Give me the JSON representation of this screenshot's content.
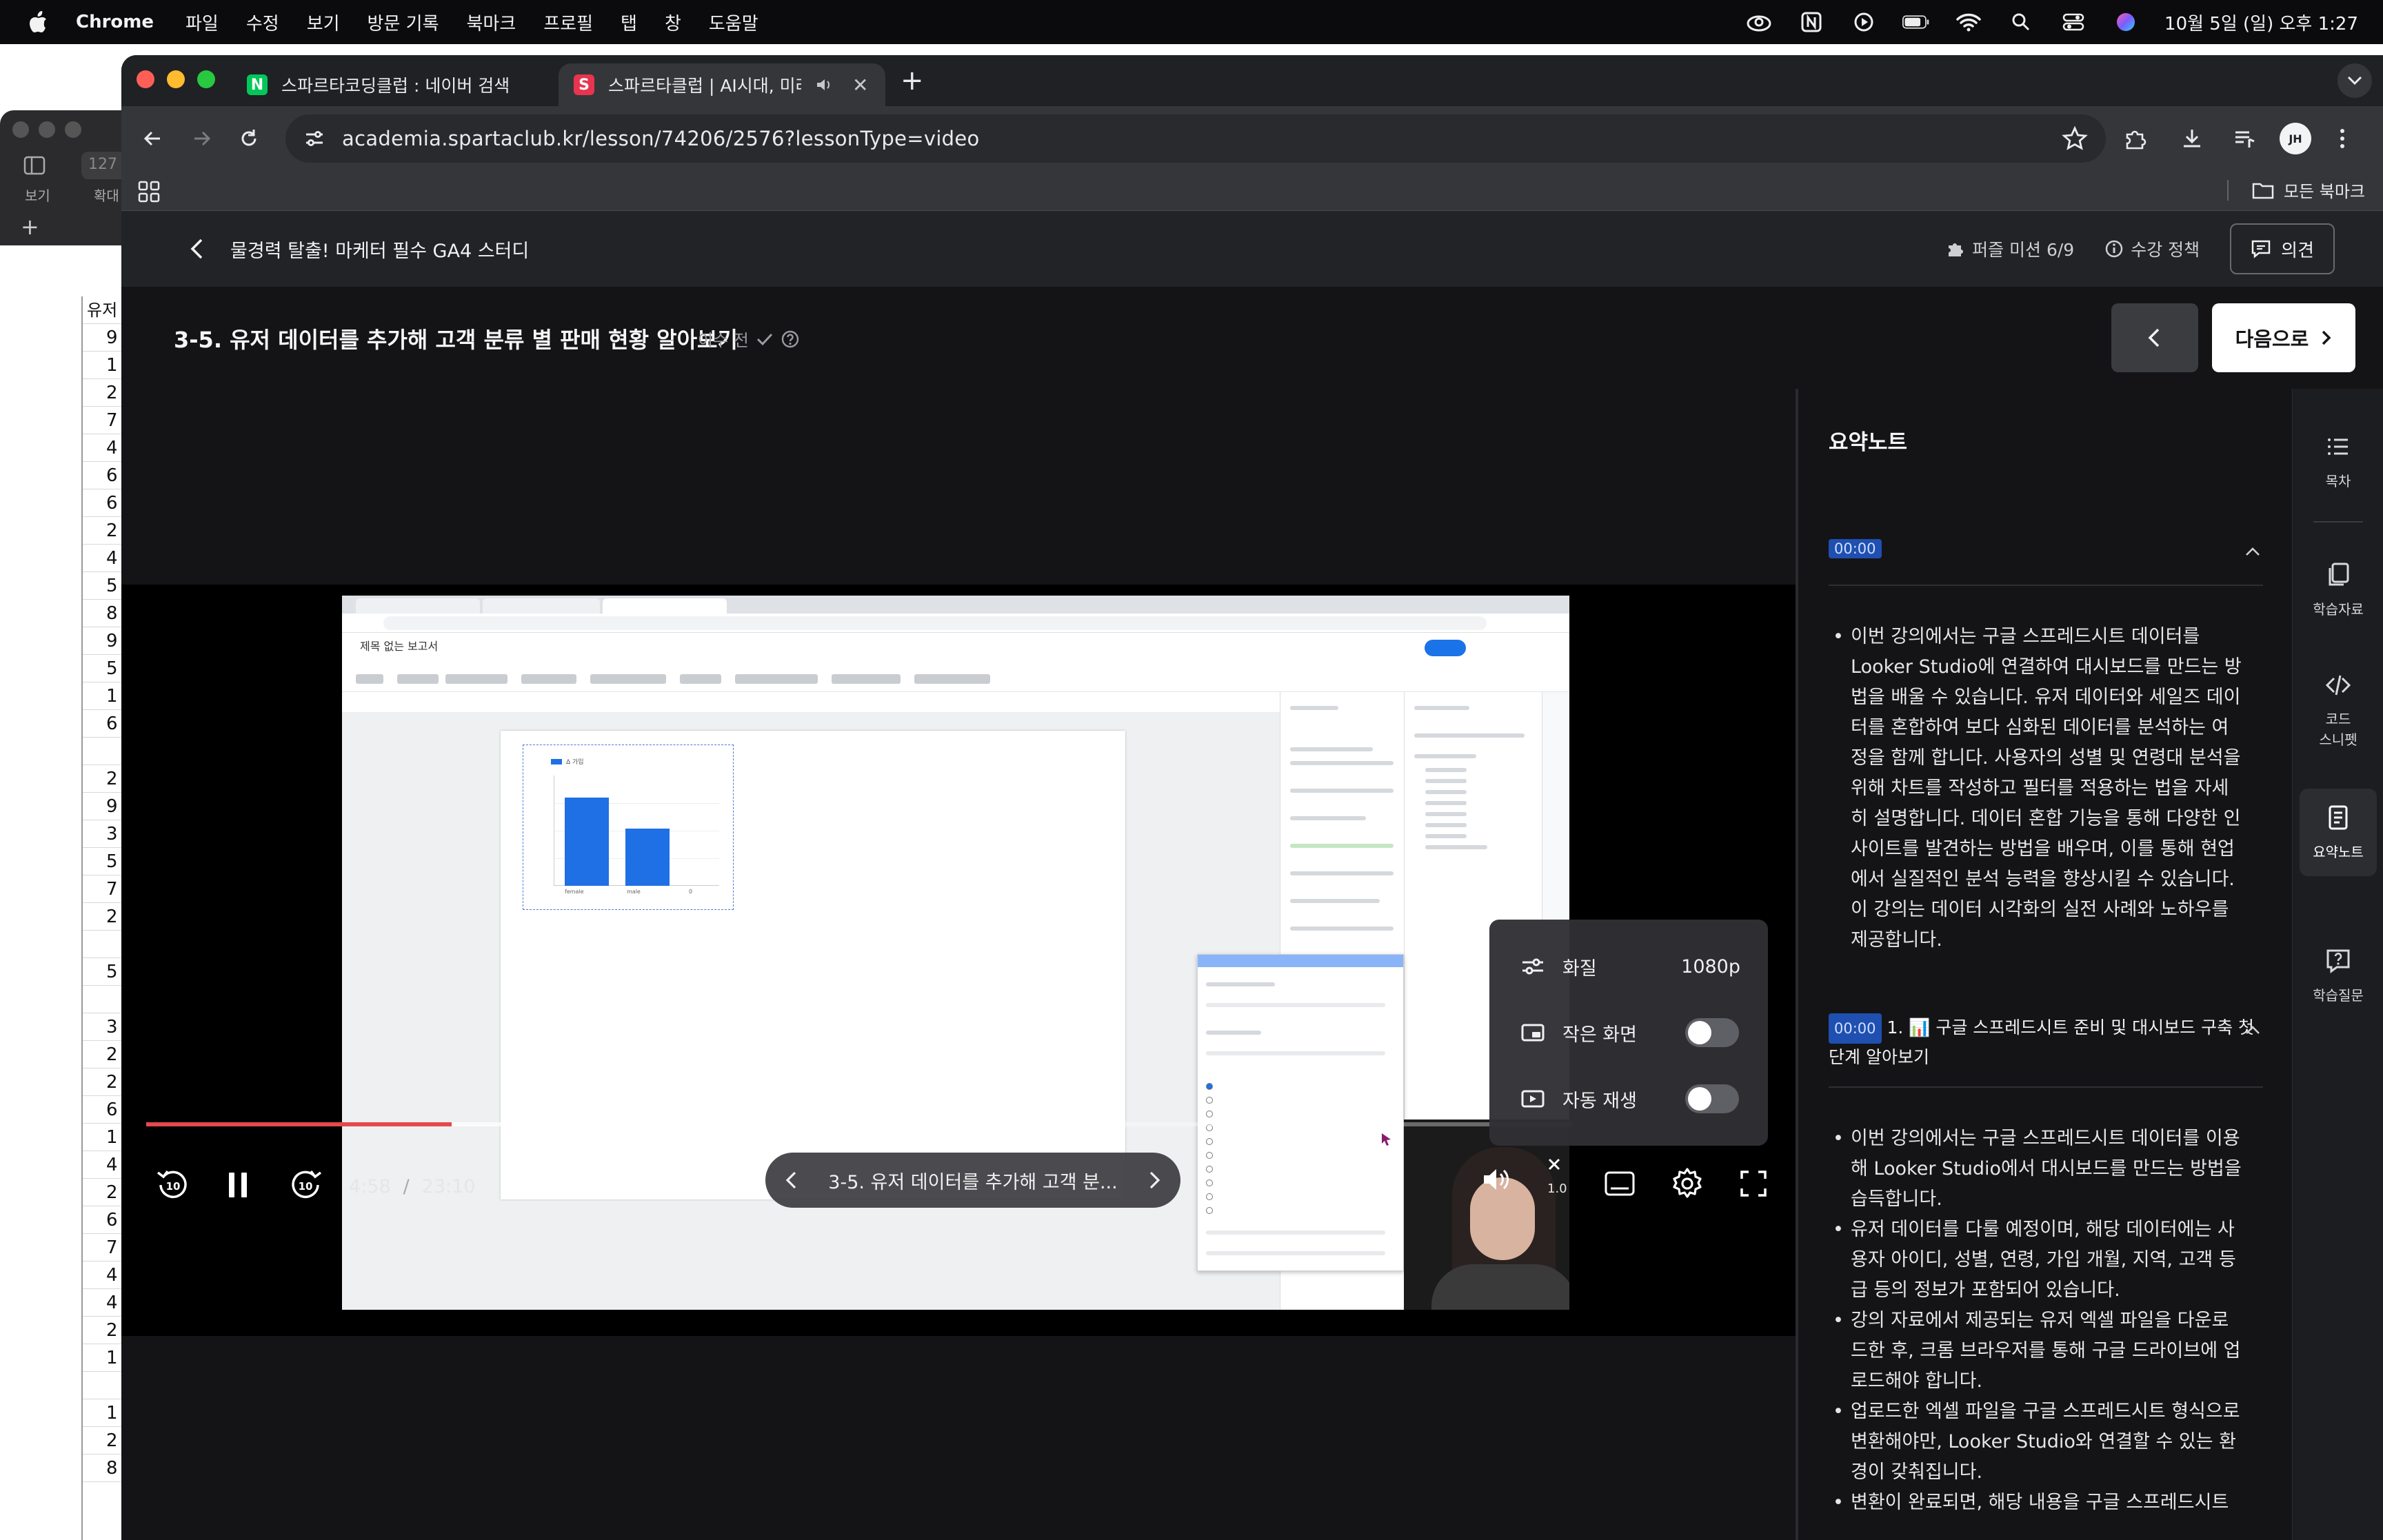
{
  "menubar": {
    "app": "Chrome",
    "items": [
      "파일",
      "수정",
      "보기",
      "방문 기록",
      "북마크",
      "프로필",
      "탭",
      "창",
      "도움말"
    ],
    "clock": "10월 5일 (일) 오후 1:27"
  },
  "bg_window": {
    "toolbar_labels": [
      "보기",
      "확대"
    ],
    "url_fragment": "127",
    "sheet_header": "유저",
    "sheet_values": [
      "9",
      "1",
      "2",
      "7",
      "4",
      "6",
      "6",
      "2",
      "4",
      "5",
      "8",
      "9",
      "5",
      "1",
      "6",
      "",
      "2",
      "9",
      "3",
      "5",
      "7",
      "2",
      "",
      "5",
      "",
      "3",
      "2",
      "2",
      "6",
      "1",
      "4",
      "2",
      "6",
      "7",
      "4",
      "4",
      "2",
      "1",
      "",
      "1",
      "2",
      "8"
    ]
  },
  "tabs": [
    {
      "favicon": "N",
      "title": "스파르타코딩클럽 : 네이버 검색"
    },
    {
      "favicon": "S",
      "title": "스파르타클럽 | AI시대, 미래를"
    }
  ],
  "address_bar": {
    "url": "academia.spartaclub.kr/lesson/74206/2576?lessonType=video"
  },
  "profile_initials": "JH",
  "bookmarks": {
    "all_label": "모든 북마크"
  },
  "course": {
    "title": "물경력 탈출! 마케터 필수 GA4 스터디",
    "puzzle_mission": "퍼즐 미션 6/9",
    "policy": "수강 정책",
    "opinion": "의견"
  },
  "lesson": {
    "title": "3-5. 유저 데이터를 추가해 고객 분류 별 판매 현황 알아보기",
    "status": "이수 전",
    "next_label": "다음으로"
  },
  "player": {
    "current_time": "4:58",
    "duration": "23:10",
    "progress_fraction": 0.214,
    "buffered_fraction": 0.265,
    "chapter_title": "3-5. 유저 데이터를 추가해 고객 분...",
    "speed": "1.0",
    "settings": {
      "quality_label": "화질",
      "quality_value": "1080p",
      "pip_label": "작은 화면",
      "pip_on": false,
      "autoplay_label": "자동 재생",
      "autoplay_on": false
    }
  },
  "video_content": {
    "doc_title": "제목 없는 보고서",
    "legend": "Δ 가입",
    "x_labels": [
      "female",
      "male",
      "0"
    ],
    "bar_values": [
      0.8,
      0.52
    ]
  },
  "notes": {
    "title": "요약노트",
    "sections": [
      {
        "timestamp": "00:00",
        "heading": "",
        "bullets": [
          "이번 강의에서는 구글 스프레드시트 데이터를 Looker Studio에 연결하여 대시보드를 만드는 방법을 배울 수 있습니다. 유저 데이터와 세일즈 데이터를 혼합하여 보다 심화된 데이터를 분석하는 여정을 함께 합니다. 사용자의 성별 및 연령대 분석을 위해 차트를 작성하고 필터를 적용하는 법을 자세히 설명합니다. 데이터 혼합 기능을 통해 다양한 인사이트를 발견하는 방법을 배우며, 이를 통해 현업에서 실질적인 분석 능력을 향상시킬 수 있습니다. 이 강의는 데이터 시각화의 실전 사례와 노하우를 제공합니다."
        ]
      },
      {
        "timestamp": "00:00",
        "heading": "1. 📊 구글 스프레드시트 준비 및 대시보드 구축 첫 단계 알아보기",
        "bullets": [
          "이번 강의에서는 구글 스프레드시트 데이터를 이용해 Looker Studio에서 대시보드를 만드는 방법을 습득합니다.",
          "유저 데이터를 다룰 예정이며, 해당 데이터에는 사용자 아이디, 성별, 연령, 가입 개월, 지역, 고객 등급 등의 정보가 포함되어 있습니다.",
          "강의 자료에서 제공되는 유저 엑셀 파일을 다운로드한 후, 크롬 브라우저를 통해 구글 드라이브에 업로드해야 합니다.",
          "업로드한 엑셀 파일을 구글 스프레드시트 형식으로 변환해야만, Looker Studio와 연결할 수 있는 환경이 갖춰집니다.",
          "변환이 완료되면, 해당 내용을 구글 스프레드시트"
        ]
      }
    ]
  },
  "rail": [
    {
      "icon": "list-icon",
      "label": "목차"
    },
    {
      "icon": "copy-icon",
      "label": "학습자료"
    },
    {
      "icon": "code-icon",
      "label": "코드\n스니펫"
    },
    {
      "icon": "note-icon",
      "label": "요약노트"
    },
    {
      "icon": "question-icon",
      "label": "학습질문"
    }
  ],
  "colors": {
    "progress": "#e5484d",
    "timestamp_badge": "#1f4fb0",
    "page_bg": "#141417",
    "traffic_red": "#ff5f57",
    "traffic_yellow": "#febc2e",
    "traffic_green": "#28c840",
    "naver_green": "#03c75a",
    "sparta_red": "#e8344e"
  }
}
